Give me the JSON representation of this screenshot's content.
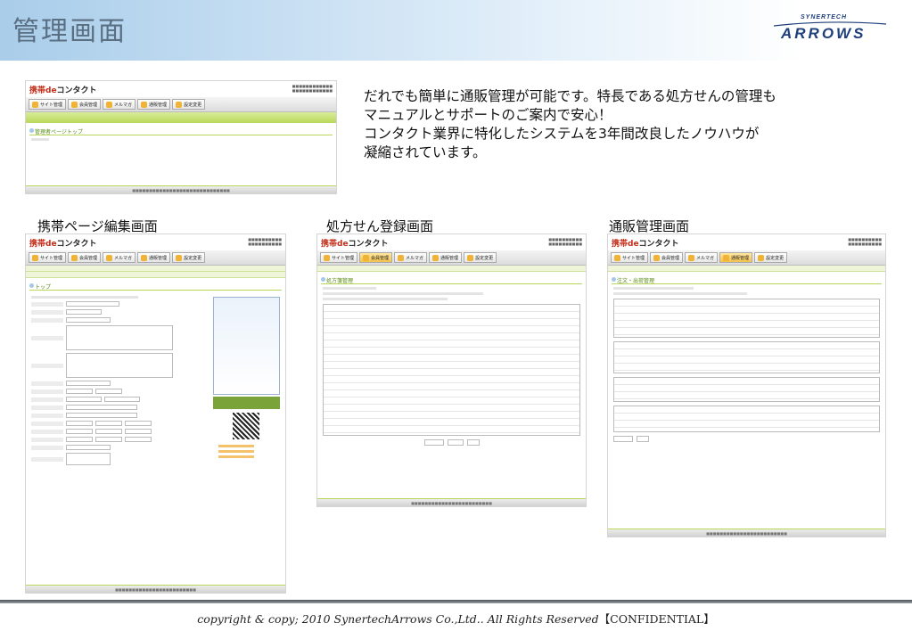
{
  "slide": {
    "title": "管理画面",
    "logo": {
      "top": "SYNERTECH",
      "main": "ARROWS"
    },
    "description": [
      "だれでも簡単に通販管理が可能です。特長である処方せんの管理も",
      "マニュアルとサポートのご案内で安心！",
      "コンタクト業界に特化したシステムを3年間改良したノウハウが",
      "凝縮されています。"
    ],
    "captions": {
      "mobile": "携帯ページ編集画面",
      "prescription": "処方せん登録画面",
      "mailorder": "通販管理画面"
    },
    "footer": {
      "copyright": "copyright & copy; 2010 SynertechArrows Co.,Ltd.. All Rights Reserved",
      "confidential": "【CONFIDENTIAL】"
    }
  },
  "mock": {
    "logo_red": "携帯de",
    "logo_black": "コンタクト",
    "nav": [
      "サイト管理",
      "会員管理",
      "メルマガ",
      "通販管理",
      "設定変更"
    ],
    "top_heading": "管理者ページトップ",
    "mobile_heading": "トップ",
    "prescription_heading": "処方箋管理",
    "order_heading": "注文・出荷管理"
  }
}
